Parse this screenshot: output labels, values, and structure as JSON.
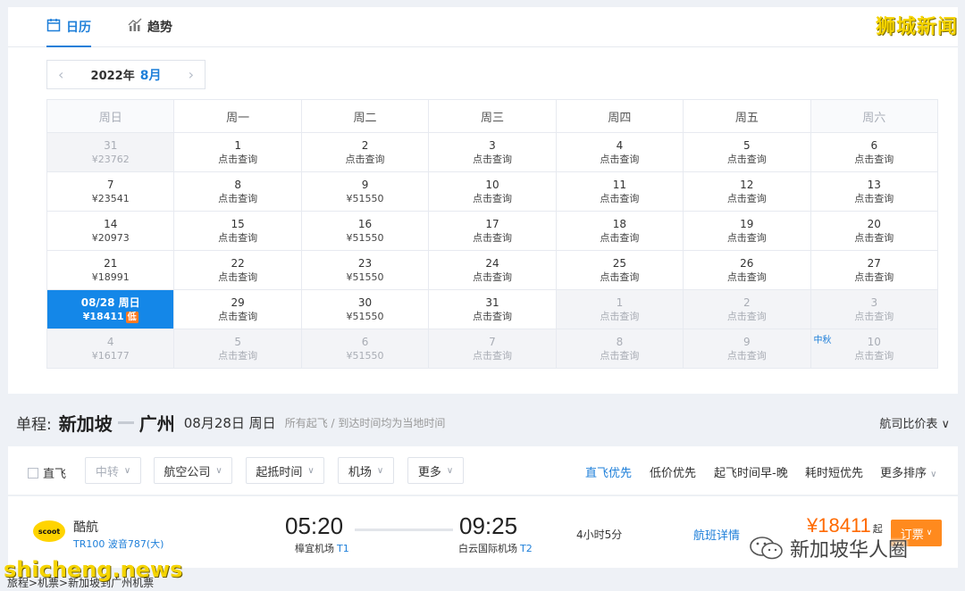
{
  "tabs": {
    "calendar": "日历",
    "trend": "趋势"
  },
  "watermark": "狮城新闻",
  "month_nav": {
    "year": "2022年",
    "month": "8月"
  },
  "weekdays": [
    "周日",
    "周一",
    "周二",
    "周三",
    "周四",
    "周五",
    "周六"
  ],
  "calendar_rows": [
    [
      {
        "day": "31",
        "price": "¥23762",
        "grey": true
      },
      {
        "day": "1",
        "price": "点击查询"
      },
      {
        "day": "2",
        "price": "点击查询"
      },
      {
        "day": "3",
        "price": "点击查询"
      },
      {
        "day": "4",
        "price": "点击查询"
      },
      {
        "day": "5",
        "price": "点击查询"
      },
      {
        "day": "6",
        "price": "点击查询"
      }
    ],
    [
      {
        "day": "7",
        "price": "¥23541"
      },
      {
        "day": "8",
        "price": "点击查询"
      },
      {
        "day": "9",
        "price": "¥51550"
      },
      {
        "day": "10",
        "price": "点击查询"
      },
      {
        "day": "11",
        "price": "点击查询"
      },
      {
        "day": "12",
        "price": "点击查询"
      },
      {
        "day": "13",
        "price": "点击查询"
      }
    ],
    [
      {
        "day": "14",
        "price": "¥20973"
      },
      {
        "day": "15",
        "price": "点击查询"
      },
      {
        "day": "16",
        "price": "¥51550"
      },
      {
        "day": "17",
        "price": "点击查询"
      },
      {
        "day": "18",
        "price": "点击查询"
      },
      {
        "day": "19",
        "price": "点击查询"
      },
      {
        "day": "20",
        "price": "点击查询"
      }
    ],
    [
      {
        "day": "21",
        "price": "¥18991"
      },
      {
        "day": "22",
        "price": "点击查询"
      },
      {
        "day": "23",
        "price": "¥51550"
      },
      {
        "day": "24",
        "price": "点击查询"
      },
      {
        "day": "25",
        "price": "点击查询"
      },
      {
        "day": "26",
        "price": "点击查询"
      },
      {
        "day": "27",
        "price": "点击查询"
      }
    ],
    [
      {
        "day": "08/28 周日",
        "price": "¥18411",
        "selected": true,
        "low": "低"
      },
      {
        "day": "29",
        "price": "点击查询"
      },
      {
        "day": "30",
        "price": "¥51550"
      },
      {
        "day": "31",
        "price": "点击查询"
      },
      {
        "day": "1",
        "price": "点击查询",
        "grey": true
      },
      {
        "day": "2",
        "price": "点击查询",
        "grey": true
      },
      {
        "day": "3",
        "price": "点击查询",
        "grey": true
      }
    ],
    [
      {
        "day": "4",
        "price": "¥16177",
        "grey": true
      },
      {
        "day": "5",
        "price": "点击查询",
        "grey": true
      },
      {
        "day": "6",
        "price": "¥51550",
        "grey": true
      },
      {
        "day": "7",
        "price": "点击查询",
        "grey": true
      },
      {
        "day": "8",
        "price": "点击查询",
        "grey": true
      },
      {
        "day": "9",
        "price": "点击查询",
        "grey": true
      },
      {
        "day": "10",
        "price": "点击查询",
        "grey": true,
        "holiday": "中秋"
      }
    ]
  ],
  "route": {
    "label": "单程:",
    "from": "新加坡",
    "to": "广州",
    "date": "08月28日 周日",
    "note": "所有起飞 / 到达时间均为当地时间",
    "compare": "航司比价表"
  },
  "filters": {
    "direct": "直飞",
    "transfer": "中转",
    "airline": "航空公司",
    "time": "起抵时间",
    "airport": "机场",
    "more": "更多"
  },
  "sorts": [
    "直飞优先",
    "低价优先",
    "起飞时间早-晚",
    "耗时短优先",
    "更多排序"
  ],
  "flight": {
    "logo": "scoot",
    "airline": "酷航",
    "number": "TR100 波音787(大)",
    "dep_time": "05:20",
    "dep_airport": "樟宜机场",
    "dep_terminal": "T1",
    "arr_time": "09:25",
    "arr_airport": "白云国际机场",
    "arr_terminal": "T2",
    "duration": "4小时5分",
    "detail": "航班详情",
    "price": "¥18411",
    "price_suffix": "起",
    "book": "订票"
  },
  "overlay": {
    "wechat": "新加坡华人圈",
    "site": "shicheng.news",
    "breadcrumb": "旅程>机票>新加坡到广州机票"
  },
  "colors": {
    "accent": "#1e7fd9",
    "selected": "#1487e8",
    "price": "#ff6a00",
    "book": "#ff8a1e"
  }
}
